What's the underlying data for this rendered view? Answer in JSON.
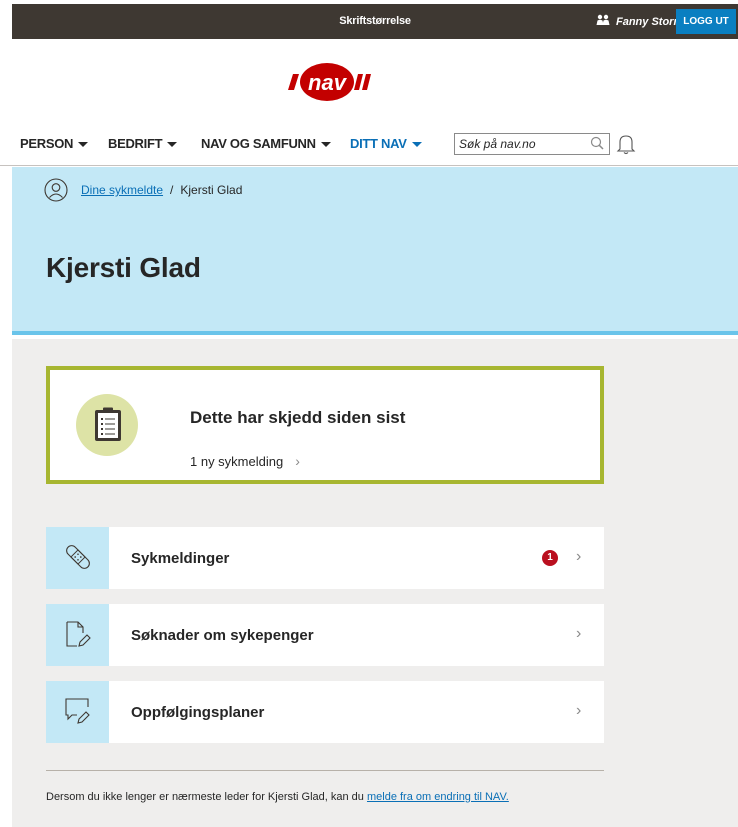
{
  "topbar": {
    "font_size_label": "Skriftstørrelse",
    "user_name": "Fanny Storm",
    "logout_label": "LOGG UT"
  },
  "logo": {
    "text": "nav"
  },
  "nav": {
    "items": [
      {
        "label": "PERSON"
      },
      {
        "label": "BEDRIFT"
      },
      {
        "label": "NAV OG SAMFUNN"
      },
      {
        "label": "DITT NAV"
      }
    ],
    "search_placeholder": "Søk på nav.no"
  },
  "breadcrumb": {
    "parent": "Dine sykmeldte",
    "separator": "/",
    "current": "Kjersti Glad"
  },
  "page_title": "Kjersti Glad",
  "news_card": {
    "title": "Dette har skjedd siden sist",
    "item": "1 ny sykmelding"
  },
  "rows": [
    {
      "label": "Sykmeldinger",
      "badge": "1"
    },
    {
      "label": "Søknader om sykepenger"
    },
    {
      "label": "Oppfølgingsplaner"
    }
  ],
  "footer": {
    "text": "Dersom du ikke lenger er nærmeste leder for Kjersti Glad, kan du",
    "link": "melde fra om endring til NAV."
  },
  "colors": {
    "brand_red": "#c30000",
    "accent_blue": "#0a6fb6",
    "header_band": "#c3e8f6",
    "card_border": "#a7b631",
    "badge_red": "#ba0f1f"
  }
}
